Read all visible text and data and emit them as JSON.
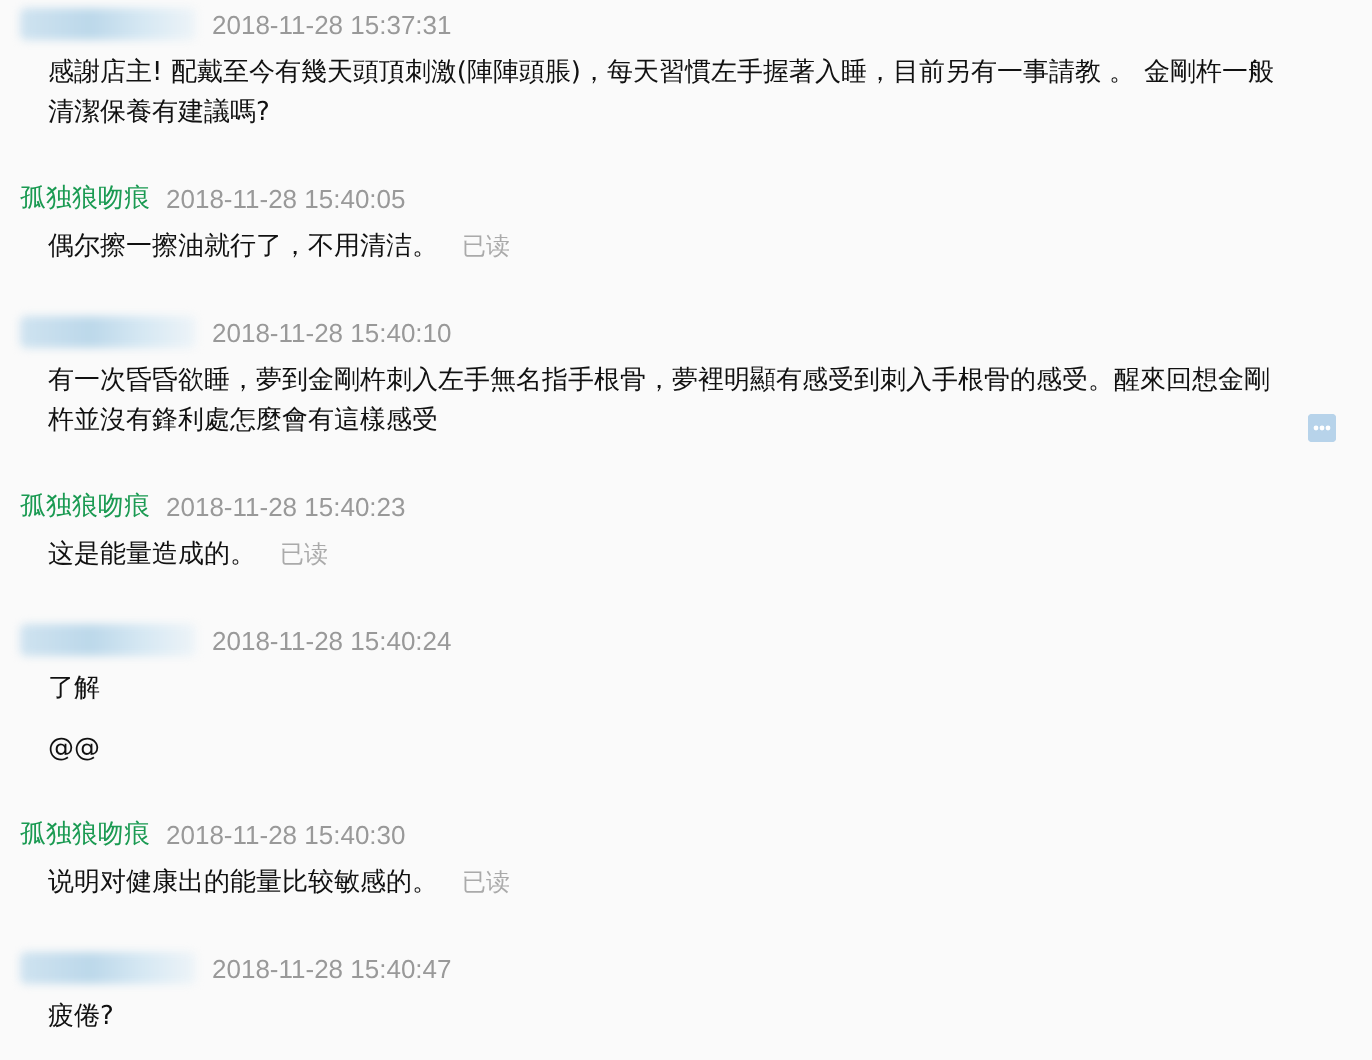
{
  "messages": [
    {
      "sender": {
        "kind": "blurred"
      },
      "time": "2018-11-28 15:37:31",
      "texts": [
        "感謝店主! 配戴至今有幾天頭頂刺激(陣陣頭脹)，每天習慣左手握著入睡，目前另有一事請教 。 金剛杵一般清潔保養有建議嗎?"
      ]
    },
    {
      "sender": {
        "kind": "named",
        "name": "孤独狼吻痕"
      },
      "time": "2018-11-28 15:40:05",
      "texts": [
        "偶尔擦一擦油就行了，不用清洁。"
      ],
      "read_label": "已读"
    },
    {
      "sender": {
        "kind": "blurred"
      },
      "time": "2018-11-28 15:40:10",
      "texts": [
        "有一次昏昏欲睡，夢到金剛杵刺入左手無名指手根骨，夢裡明顯有感受到刺入手根骨的感受。醒來回想金剛杵並沒有鋒利處怎麼會有這樣感受"
      ],
      "has_menu": true
    },
    {
      "sender": {
        "kind": "named",
        "name": "孤独狼吻痕"
      },
      "time": "2018-11-28 15:40:23",
      "texts": [
        "这是能量造成的。"
      ],
      "read_label": "已读"
    },
    {
      "sender": {
        "kind": "blurred"
      },
      "time": "2018-11-28 15:40:24",
      "texts": [
        "了解",
        "@@"
      ]
    },
    {
      "sender": {
        "kind": "named",
        "name": "孤独狼吻痕"
      },
      "time": "2018-11-28 15:40:30",
      "texts": [
        "说明对健康出的能量比较敏感的。"
      ],
      "read_label": "已读"
    },
    {
      "sender": {
        "kind": "blurred"
      },
      "time": "2018-11-28 15:40:47",
      "texts": [
        "疲倦?"
      ]
    }
  ]
}
